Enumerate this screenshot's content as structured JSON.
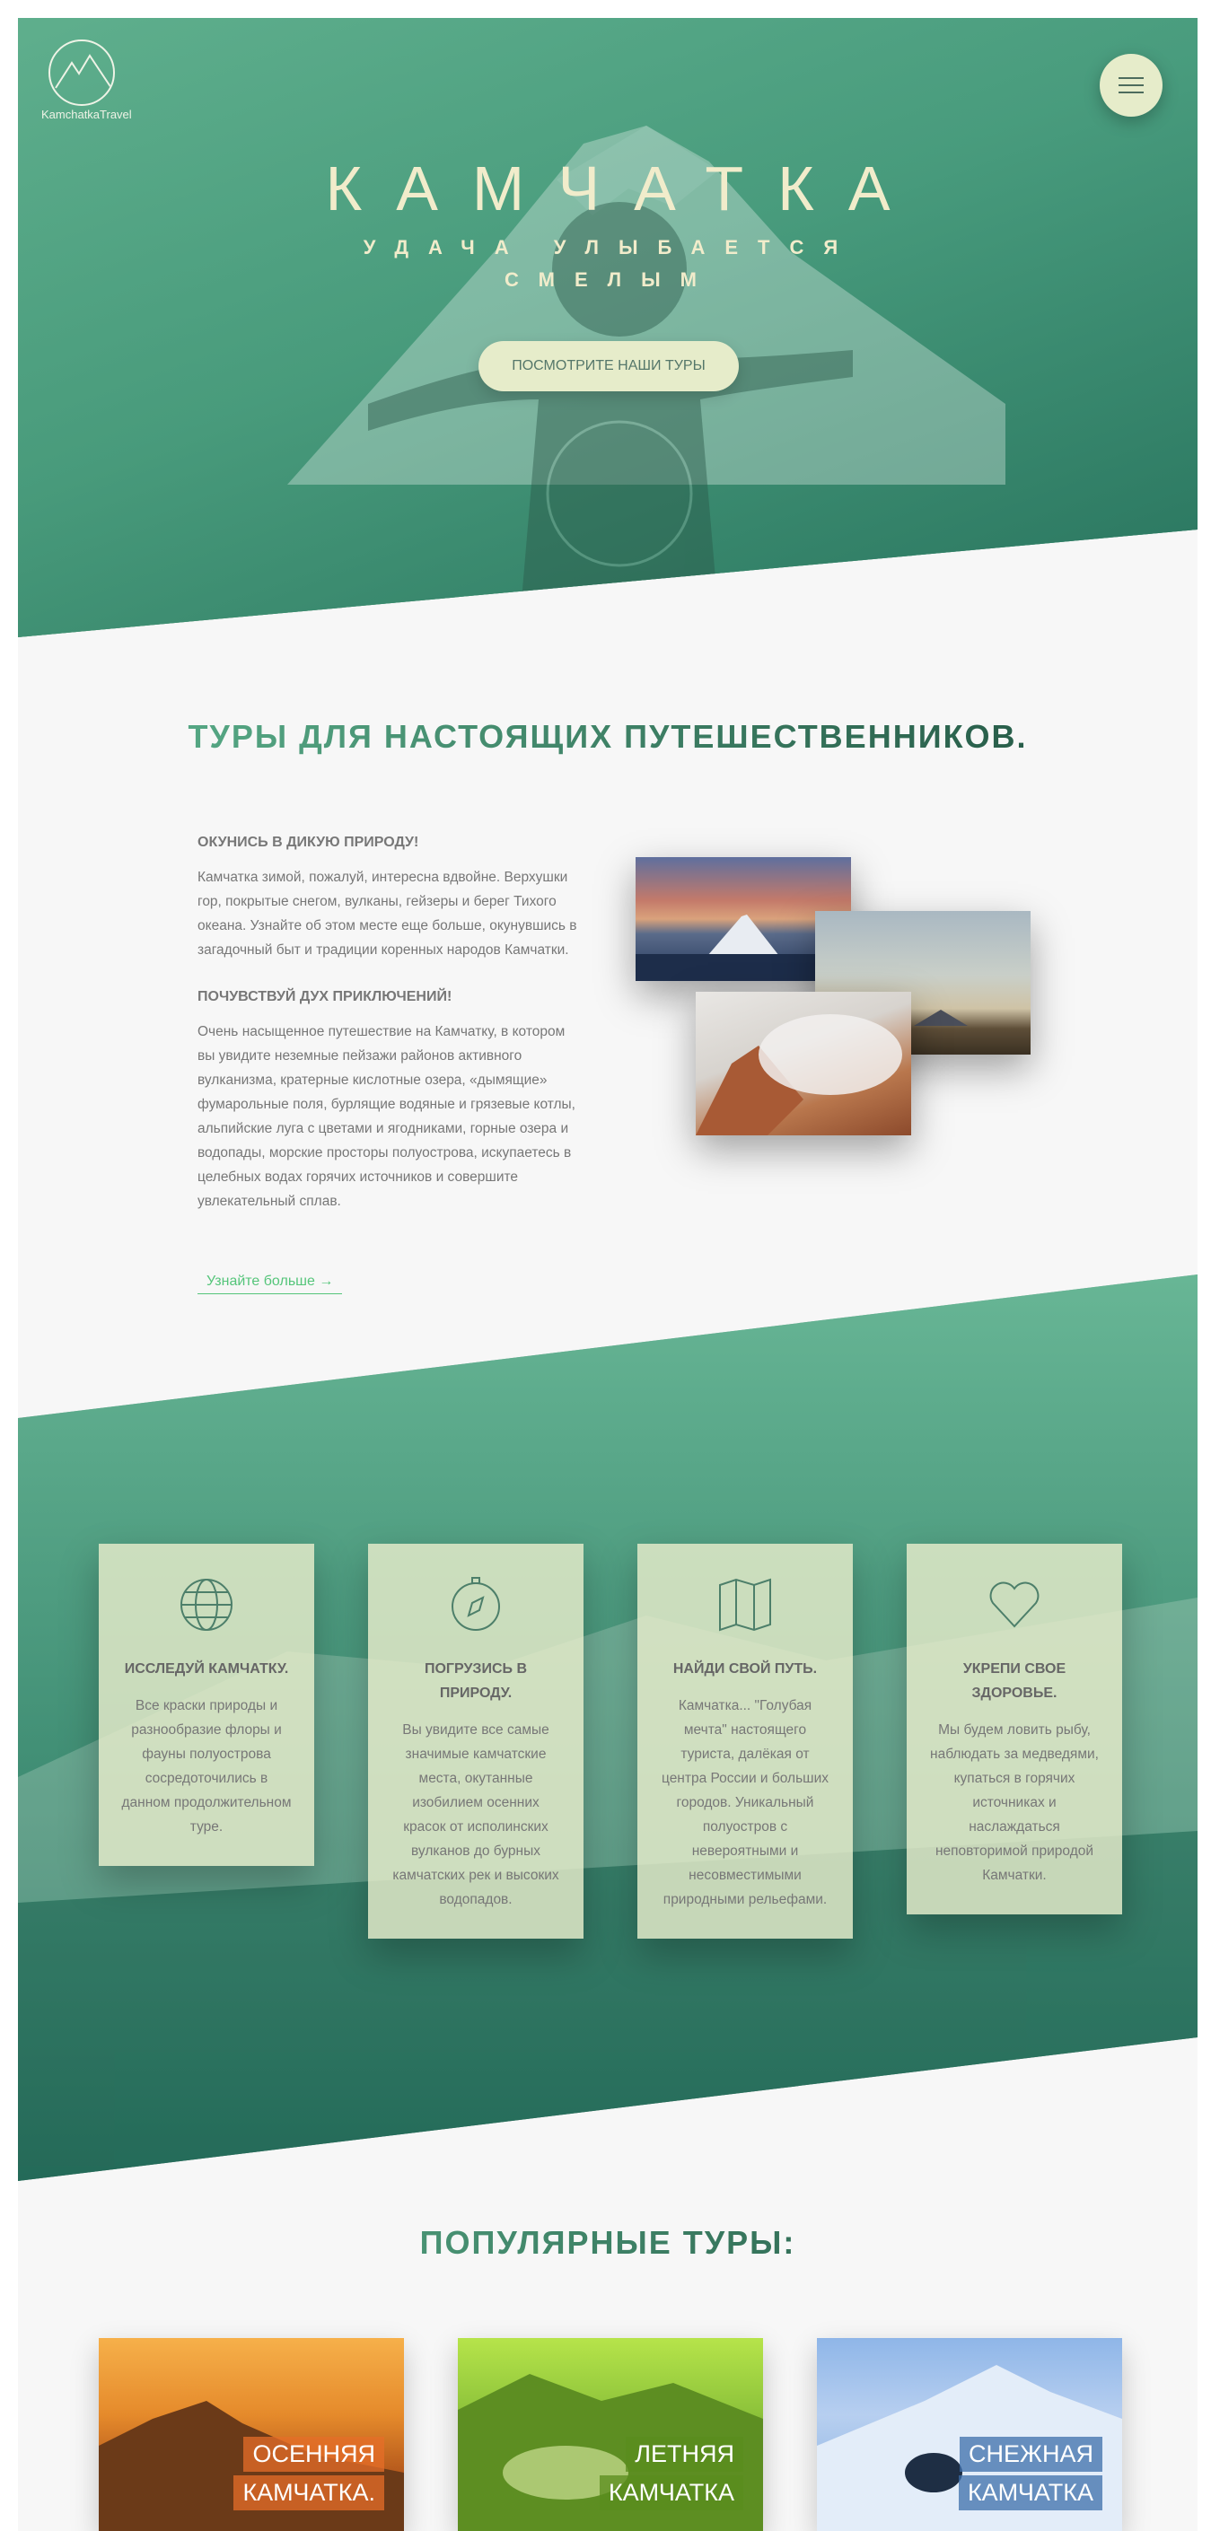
{
  "header": {
    "logo_text": "KamchatkaTravel",
    "title": "КАМЧАТКА",
    "subtitle": "УДАЧА УЛЫБАЕТСЯ СМЕЛЫМ",
    "cta_label": "ПОСМОТРИТЕ НАШИ ТУРЫ"
  },
  "about": {
    "heading": "ТУРЫ ДЛЯ НАСТОЯЩИХ ПУТЕШЕСТВЕННИКОВ.",
    "block1_title": "ОКУНИСЬ В ДИКУЮ ПРИРОДУ!",
    "block1_text": "Камчатка зимой, пожалуй, интересна вдвойне. Верхушки гор, покрытые снегом, вулканы, гейзеры и берег Тихого океана. Узнайте об этом месте еще больше, окунувшись в загадочный быт и традиции коренных народов Камчатки.",
    "block2_title": "ПОЧУВСТВУЙ ДУХ ПРИКЛЮЧЕНИЙ!",
    "block2_text": "Очень насыщенное путешествие на Камчатку, в котором вы увидите неземные пейзажи районов активного вулканизма, кратерные кислотные озера, «дымящие» фумарольные поля, бурлящие водяные и грязевые котлы, альпийские луга с цветами и ягодниками, горные озера и водопады, морские просторы полуострова, искупаетесь в целебных водах горячих источников и совершите увлекательный сплав.",
    "learn_more": "Узнайте больше →"
  },
  "features": [
    {
      "icon": "globe-icon",
      "title": "ИССЛЕДУЙ КАМЧАТКУ.",
      "text": "Все краски природы и разнообразие флоры и фауны полуострова сосредоточились в данном продолжительном туре."
    },
    {
      "icon": "compass-icon",
      "title": "ПОГРУЗИСЬ В ПРИРОДУ.",
      "text": "Вы увидите все самые значимые камчатские места, окутанные изобилием осенних красок от исполинских вулканов до бурных камчатских рек и высоких водопадов."
    },
    {
      "icon": "map-icon",
      "title": "НАЙДИ СВОЙ ПУТЬ.",
      "text": "Камчатка... \"Голубая мечта\" настоящего туриста, далёкая от центра России и больших городов. Уникальный полуостров с невероятными и несовместимыми природными рельефами."
    },
    {
      "icon": "heart-icon",
      "title": "УКРЕПИ СВОЕ ЗДОРОВЬЕ.",
      "text": "Мы будем ловить рыбу, наблюдать за медведями, купаться в горячих источниках и наслаждаться неповторимой природой Камчатки."
    }
  ],
  "tours": {
    "heading": "ПОПУЛЯРНЫЕ ТУРЫ:",
    "cards": [
      {
        "line1": "ОСЕННЯЯ",
        "line2": "КАМЧАТКА."
      },
      {
        "line1": "ЛЕТНЯЯ",
        "line2": "КАМЧАТКА"
      },
      {
        "line1": "СНЕЖНАЯ",
        "line2": "КАМЧАТКА"
      }
    ]
  },
  "colors": {
    "accent_green": "#55c57a",
    "cream": "#e6ecca",
    "dark_green": "#1f4f3e"
  }
}
